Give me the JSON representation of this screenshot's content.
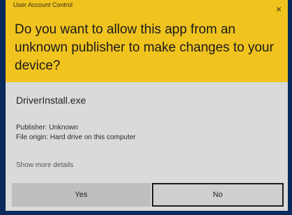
{
  "dialog": {
    "title": "User Account Control",
    "close_glyph": "×",
    "question": "Do you want to allow this app from an unknown publisher to make changes to your device?",
    "app_name": "DriverInstall.exe",
    "publisher": "Publisher: Unknown",
    "file_origin": "File origin: Hard drive on this computer",
    "show_details": "Show more details",
    "yes_label": "Yes",
    "no_label": "No"
  },
  "colors": {
    "header": "#f0c31f",
    "body": "#dadada",
    "border": "#0b2a5c"
  },
  "icons": [
    "close-icon"
  ]
}
